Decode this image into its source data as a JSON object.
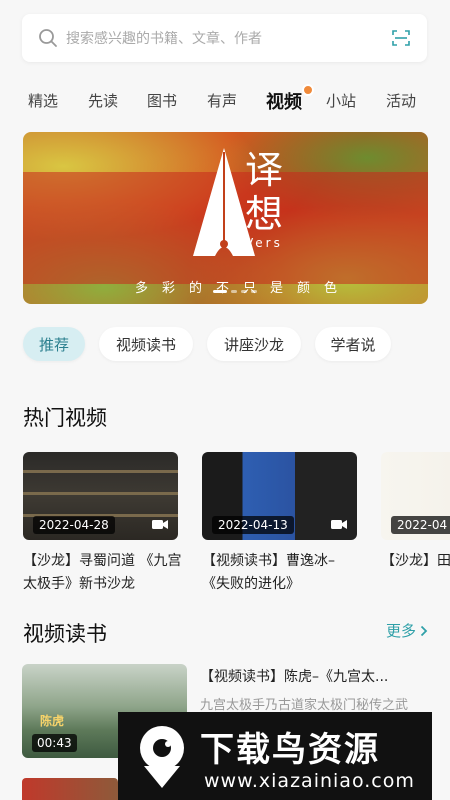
{
  "search": {
    "placeholder": "搜索感兴趣的书籍、文章、作者",
    "icon": "search-icon",
    "scan_icon": "scan-icon"
  },
  "tabs": [
    {
      "label": "精选"
    },
    {
      "label": "先读"
    },
    {
      "label": "图书"
    },
    {
      "label": "有声"
    },
    {
      "label": "视频",
      "active": true
    },
    {
      "label": "小站"
    },
    {
      "label": "活动"
    }
  ],
  "banner": {
    "title": "译想",
    "subtitle": "Vers",
    "slogan": "多彩的不只是颜色",
    "slide_count": 4,
    "active_slide": 1
  },
  "chips": [
    {
      "label": "推荐",
      "active": true
    },
    {
      "label": "视频读书"
    },
    {
      "label": "讲座沙龙"
    },
    {
      "label": "学者说"
    }
  ],
  "hot": {
    "heading": "热门视频",
    "items": [
      {
        "date": "2022-04-28",
        "title": "【沙龙】寻蜀问道 《九宫太极手》新书沙龙"
      },
      {
        "date": "2022-04-13",
        "title": "【视频读书】曹逸冰–《失败的进化》"
      },
      {
        "date": "2022-04",
        "title": "【沙龙】田法与技艺N"
      }
    ]
  },
  "reading": {
    "heading": "视频读书",
    "more_label": "更多",
    "items": [
      {
        "duration": "00:43",
        "thumb_name": "陈虎",
        "title": "【视频读书】陈虎–《九宫太...",
        "desc": "九宫太极手乃古道家太极门秘传之武"
      }
    ]
  },
  "watermark": {
    "title": "下载鸟资源",
    "url": "www.xiazainiao.com"
  },
  "colors": {
    "accent": "#2fa0a8",
    "chip_active_bg": "#d7eef2",
    "badge": "#f08a3a"
  }
}
